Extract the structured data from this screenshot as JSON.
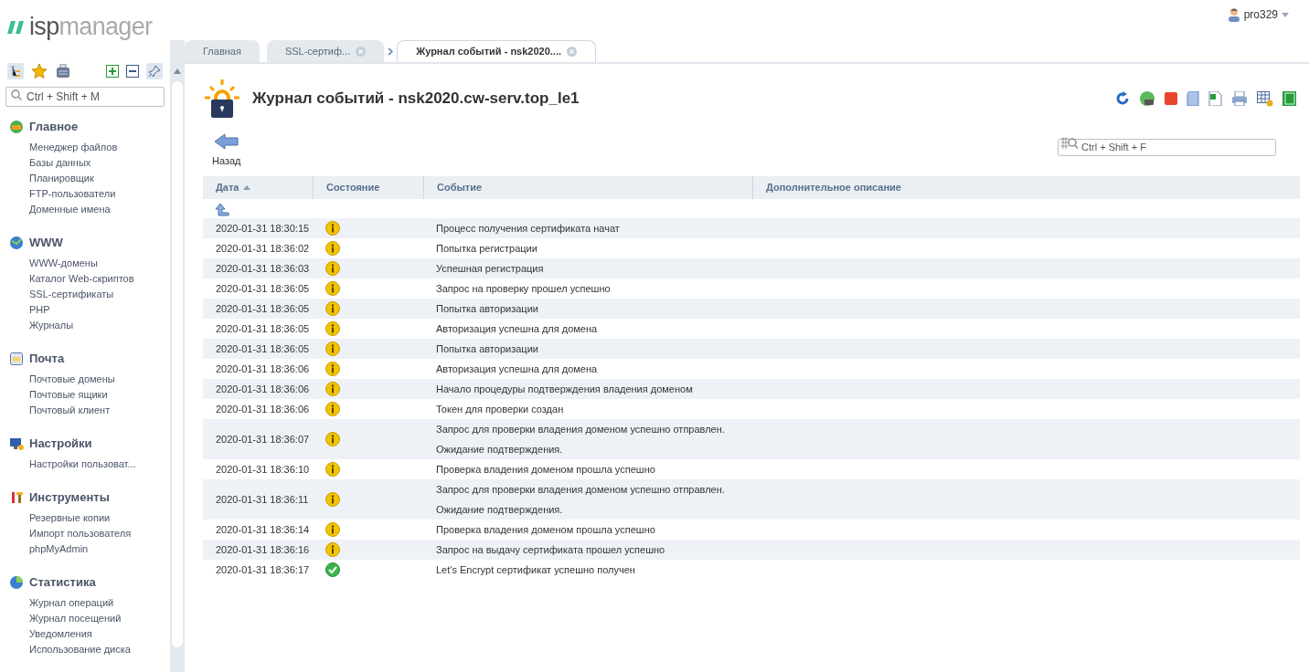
{
  "logo": {
    "part1": "isp",
    "part2": "manager"
  },
  "user": {
    "name": "pro329"
  },
  "sidebar": {
    "search_placeholder": "Ctrl + Shift + M",
    "groups": [
      {
        "kind": "home",
        "title": "Главное",
        "items": [
          "Менеджер файлов",
          "Базы данных",
          "Планировщик",
          "FTP-пользователи",
          "Доменные имена"
        ]
      },
      {
        "kind": "www",
        "title": "WWW",
        "items": [
          "WWW-домены",
          "Каталог Web-скриптов",
          "SSL-сертификаты",
          "PHP",
          "Журналы"
        ]
      },
      {
        "kind": "mail",
        "title": "Почта",
        "items": [
          "Почтовые домены",
          "Почтовые ящики",
          "Почтовый клиент"
        ]
      },
      {
        "kind": "settings",
        "title": "Настройки",
        "items": [
          "Настройки пользоват..."
        ]
      },
      {
        "kind": "tools",
        "title": "Инструменты",
        "items": [
          "Резервные копии",
          "Импорт пользователя",
          "phpMyAdmin"
        ]
      },
      {
        "kind": "stats",
        "title": "Статистика",
        "items": [
          "Журнал операций",
          "Журнал посещений",
          "Уведомления",
          "Использование диска"
        ]
      }
    ]
  },
  "tabs": [
    {
      "label": "Главная",
      "selected": false,
      "closable": false
    },
    {
      "label": "SSL-сертиф...",
      "selected": false,
      "closable": true
    },
    {
      "label": "Журнал событий - nsk2020....",
      "selected": true,
      "closable": true
    }
  ],
  "page": {
    "title": "Журнал событий - nsk2020.cw-serv.top_le1",
    "back_label": "Назад",
    "filter_placeholder": "Ctrl + Shift + F"
  },
  "table": {
    "columns": [
      {
        "label": "Дата",
        "sorted": true
      },
      {
        "label": "Состояние",
        "sorted": false
      },
      {
        "label": "Событие",
        "sorted": false
      },
      {
        "label": "Дополнительное описание",
        "sorted": false
      }
    ],
    "rows": [
      {
        "date": "2020-01-31 18:30:15",
        "kind": "info",
        "event": [
          "Процесс получения сертификата начат"
        ]
      },
      {
        "date": "2020-01-31 18:36:02",
        "kind": "info",
        "event": [
          "Попытка регистрации"
        ]
      },
      {
        "date": "2020-01-31 18:36:03",
        "kind": "info",
        "event": [
          "Успешная регистрация"
        ]
      },
      {
        "date": "2020-01-31 18:36:05",
        "kind": "info",
        "event": [
          "Запрос на проверку прошел успешно"
        ]
      },
      {
        "date": "2020-01-31 18:36:05",
        "kind": "info",
        "event": [
          "Попытка авторизации"
        ]
      },
      {
        "date": "2020-01-31 18:36:05",
        "kind": "info",
        "event": [
          "Авторизация успешна для домена"
        ]
      },
      {
        "date": "2020-01-31 18:36:05",
        "kind": "info",
        "event": [
          "Попытка авторизации"
        ]
      },
      {
        "date": "2020-01-31 18:36:06",
        "kind": "info",
        "event": [
          "Авторизация успешна для домена"
        ]
      },
      {
        "date": "2020-01-31 18:36:06",
        "kind": "info",
        "event": [
          "Начало процедуры подтверждения владения доменом"
        ]
      },
      {
        "date": "2020-01-31 18:36:06",
        "kind": "info",
        "event": [
          "Токен для проверки создан"
        ]
      },
      {
        "date": "2020-01-31 18:36:07",
        "kind": "info",
        "event": [
          "Запрос для проверки владения доменом успешно отправлен.",
          "Ожидание подтверждения."
        ]
      },
      {
        "date": "2020-01-31 18:36:10",
        "kind": "info",
        "event": [
          "Проверка владения доменом прошла успешно"
        ]
      },
      {
        "date": "2020-01-31 18:36:11",
        "kind": "info",
        "event": [
          "Запрос для проверки владения доменом успешно отправлен.",
          "Ожидание подтверждения."
        ]
      },
      {
        "date": "2020-01-31 18:36:14",
        "kind": "info",
        "event": [
          "Проверка владения доменом прошла успешно"
        ]
      },
      {
        "date": "2020-01-31 18:36:16",
        "kind": "info",
        "event": [
          "Запрос на выдачу сертификата прошел успешно"
        ]
      },
      {
        "date": "2020-01-31 18:36:17",
        "kind": "success",
        "event": [
          "Let's Encrypt сертификат успешно получен"
        ]
      }
    ]
  }
}
